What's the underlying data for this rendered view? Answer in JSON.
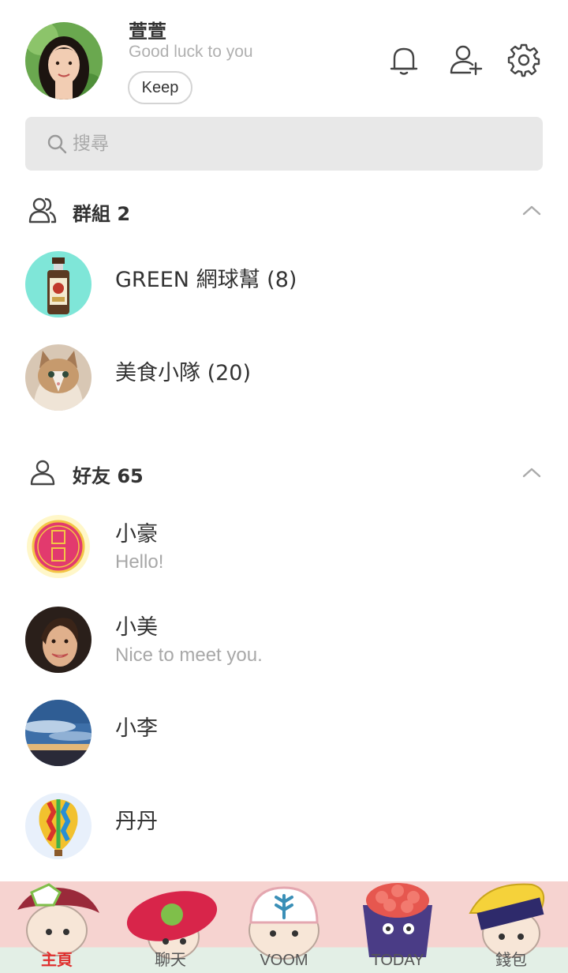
{
  "profile": {
    "name": "萱萱",
    "status": "Good luck to you",
    "keep_label": "Keep"
  },
  "header_icons": [
    "bell-icon",
    "add-friend-icon",
    "settings-gear-icon"
  ],
  "search": {
    "placeholder": "搜尋",
    "value": ""
  },
  "groups": {
    "title": "群組 2",
    "items": [
      {
        "name": "GREEN 網球幫 (8)"
      },
      {
        "name": "美食小隊 (20)"
      }
    ]
  },
  "friends": {
    "title": "好友 65",
    "items": [
      {
        "name": "小豪",
        "message": "Hello!"
      },
      {
        "name": "小美",
        "message": "Nice to meet you."
      },
      {
        "name": "小李",
        "message": ""
      },
      {
        "name": "丹丹",
        "message": ""
      }
    ]
  },
  "nav": {
    "items": [
      {
        "label": "主頁",
        "active": true
      },
      {
        "label": "聊天",
        "active": false
      },
      {
        "label": "VOOM",
        "active": false
      },
      {
        "label": "TODAY",
        "active": false
      },
      {
        "label": "錢包",
        "active": false
      }
    ]
  },
  "colors": {
    "accent_active": "#e0302f",
    "search_bg": "#e8e8e8",
    "nav_top": "#f6d3d0",
    "nav_bottom": "#e3efe6",
    "muted_text": "#a8a8a8"
  }
}
